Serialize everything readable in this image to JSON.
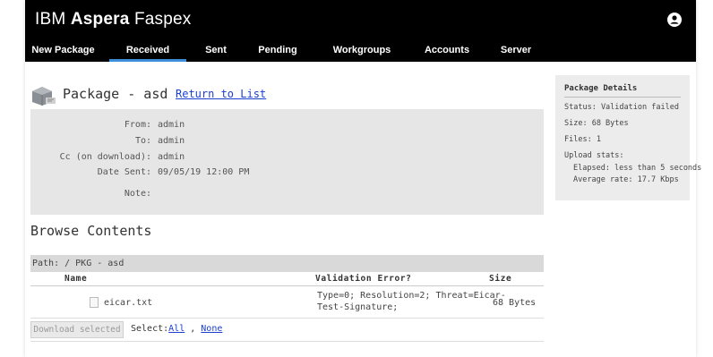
{
  "header": {
    "brand_prefix": "IBM ",
    "brand_bold": "Aspera",
    "brand_suffix": " Faspex",
    "user_icon": "user-circle-icon"
  },
  "nav": {
    "items": [
      {
        "label": "New Package"
      },
      {
        "label": "Received",
        "active": true
      },
      {
        "label": "Sent"
      },
      {
        "label": "Pending"
      },
      {
        "label": "Workgroups"
      },
      {
        "label": "Accounts"
      },
      {
        "label": "Server"
      }
    ]
  },
  "package": {
    "title": "Package - asd",
    "return_link": "Return to List",
    "fields": [
      {
        "label": "From:",
        "value": "admin"
      },
      {
        "label": "To:",
        "value": "admin"
      },
      {
        "label": "Cc (on download):",
        "value": "admin"
      },
      {
        "label": "Date Sent:",
        "value": "09/05/19 12:00 PM"
      },
      {
        "label": "Note:",
        "value": ""
      }
    ]
  },
  "browse": {
    "title": "Browse Contents",
    "path": "Path: / PKG - asd",
    "columns": [
      "Name",
      "Validation Error?",
      "Size"
    ],
    "files": [
      {
        "name": "eicar.txt",
        "validation_line1": "Type=0; Resolution=2; Threat=Eicar-",
        "validation_line2": "Test-Signature;",
        "size": "68 Bytes"
      }
    ],
    "download_button": "Download selected",
    "select_label": "Select:",
    "select_all": "All",
    "select_sep": " , ",
    "select_none": "None"
  },
  "details": {
    "title": "Package Details",
    "status": "Status: Validation failed",
    "size": "Size: 68 Bytes",
    "files": "Files: 1",
    "upload_stats": "Upload stats:",
    "elapsed": "Elapsed: less than 5 seconds",
    "average_rate": "Average rate: 17.7 Kbps"
  },
  "colors": {
    "header_bg": "#000000",
    "active_tab_underline": "#3c8ed8",
    "link": "#1a3fcf",
    "meta_bg": "#e6e6e6"
  }
}
